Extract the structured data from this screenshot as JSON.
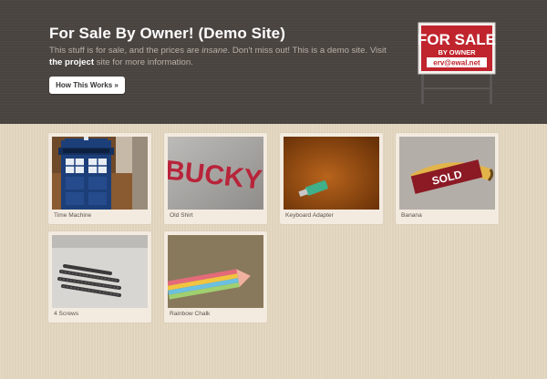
{
  "hero": {
    "title": "For Sale By Owner! (Demo Site)",
    "desc_part1": "This stuff is for sale, and the prices are ",
    "desc_emphasis": "insane",
    "desc_part2": ". Don't miss out! This is a demo site. Visit ",
    "desc_link": "the project",
    "desc_part3": " site for more information.",
    "button_label": "How This Works »"
  },
  "sign": {
    "line1": "FOR SALE",
    "line2": "BY OWNER",
    "line3": "erv@ewal.net"
  },
  "items": [
    {
      "name": "Time Machine",
      "icon": "tardis-photo"
    },
    {
      "name": "Old Shirt",
      "icon": "shirt-photo",
      "shirt_text": "BUCKY"
    },
    {
      "name": "Keyboard Adapter",
      "icon": "adapter-photo"
    },
    {
      "name": "Banana",
      "icon": "banana-photo",
      "badge": "SOLD"
    },
    {
      "name": "4 Screws",
      "icon": "screws-photo"
    },
    {
      "name": "Rainbow Chalk",
      "icon": "chalk-photo"
    }
  ],
  "colors": {
    "hero_bg": "#4a4440",
    "page_bg": "#e4d7c0",
    "sold_badge": "#8b1a24",
    "sign_red": "#c0242d"
  }
}
